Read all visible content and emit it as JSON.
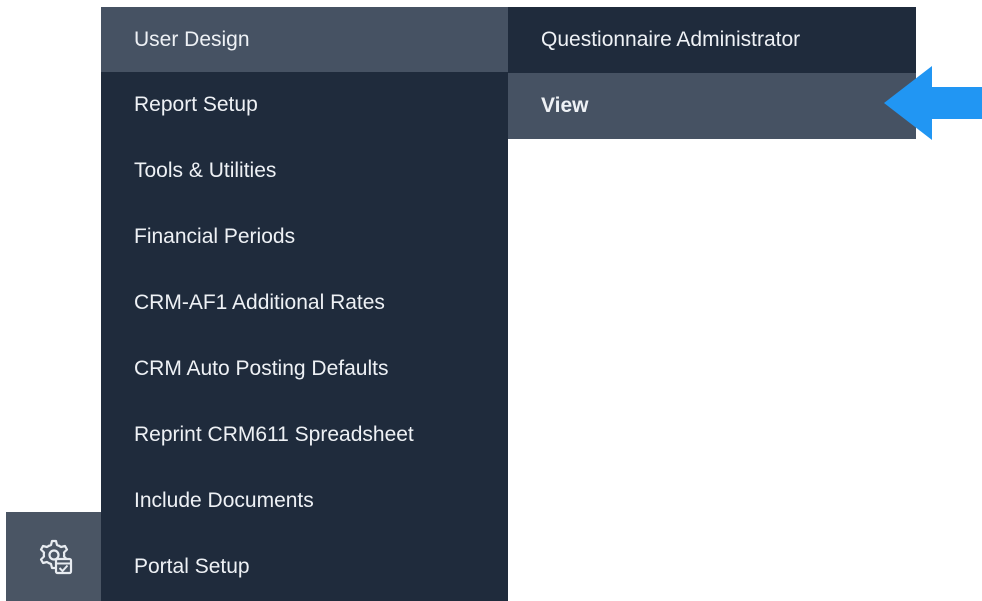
{
  "menu": {
    "items": [
      {
        "label": "User Design",
        "active": true
      },
      {
        "label": "Report Setup"
      },
      {
        "label": "Tools & Utilities"
      },
      {
        "label": "Financial Periods"
      },
      {
        "label": "CRM-AF1 Additional Rates"
      },
      {
        "label": "CRM Auto Posting Defaults"
      },
      {
        "label": "Reprint CRM611 Spreadsheet"
      },
      {
        "label": "Include Documents"
      },
      {
        "label": "Portal Setup"
      }
    ]
  },
  "submenu": {
    "items": [
      {
        "label": "Questionnaire Administrator"
      },
      {
        "label": "View",
        "active": true
      }
    ]
  },
  "icons": {
    "rail_button": "gear-calendar-icon",
    "pointer": "arrow-left-icon"
  },
  "colors": {
    "menu_bg": "#1f2b3c",
    "active_bg": "#465263",
    "rail_bg": "#4a5564",
    "arrow": "#2196f3"
  }
}
